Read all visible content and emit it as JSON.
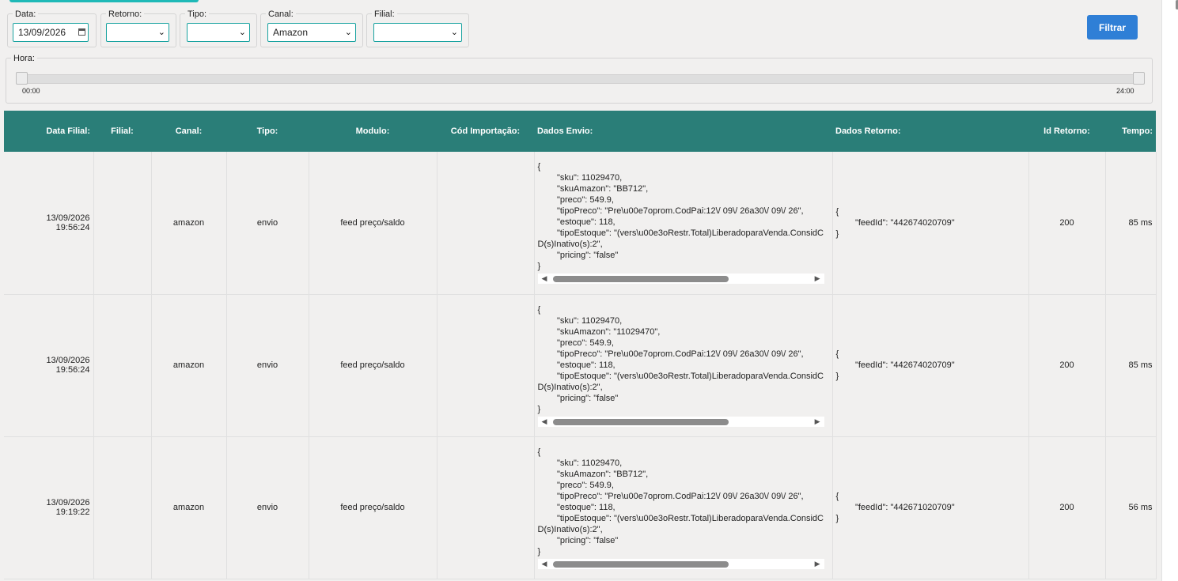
{
  "filters": {
    "data": {
      "legend": "Data:",
      "value": "13/09/2026"
    },
    "retorno": {
      "legend": "Retorno:",
      "value": ""
    },
    "tipo": {
      "legend": "Tipo:",
      "value": ""
    },
    "canal": {
      "legend": "Canal:",
      "value": "Amazon"
    },
    "filial": {
      "legend": "Filial:",
      "value": ""
    },
    "filtrar_label": "Filtrar"
  },
  "hora": {
    "legend": "Hora:",
    "min_label": "00:00",
    "max_label": "24:00",
    "range_start": 0,
    "range_end": 1
  },
  "table": {
    "headers": {
      "data_filial": "Data Filial:",
      "filial": "Filial:",
      "canal": "Canal:",
      "tipo": "Tipo:",
      "modulo": "Modulo:",
      "cod_importacao": "Cód Importação:",
      "dados_envio": "Dados Envio:",
      "dados_retorno": "Dados Retorno:",
      "id_retorno": "Id Retorno:",
      "tempo": "Tempo:"
    },
    "rows": [
      {
        "date": "13/09/2026",
        "time": "19:56:24",
        "filial": "",
        "canal": "amazon",
        "tipo": "envio",
        "modulo": "feed preço/saldo",
        "cod": "",
        "envio": "{\n        \"sku\": 11029470,\n        \"skuAmazon\": \"BB712\",\n        \"preco\": 549.9,\n        \"tipoPreco\": \"Pre\\u00e7oprom.CodPai:12\\/ 09\\/ 26a30\\/ 09\\/ 26\",\n        \"estoque\": 118,\n        \"tipoEstoque\": \"(vers\\u00e3oRestr.Total)LiberadoparaVenda.ConsidCD(s)Inativo(s):2\",\n        \"pricing\": \"false\"\n}",
        "retorno": "{\n        \"feedId\": \"442674020709\"\n}",
        "id_retorno": "200",
        "tempo": "85 ms"
      },
      {
        "date": "13/09/2026",
        "time": "19:56:24",
        "filial": "",
        "canal": "amazon",
        "tipo": "envio",
        "modulo": "feed preço/saldo",
        "cod": "",
        "envio": "{\n        \"sku\": 11029470,\n        \"skuAmazon\": \"11029470\",\n        \"preco\": 549.9,\n        \"tipoPreco\": \"Pre\\u00e7oprom.CodPai:12\\/ 09\\/ 26a30\\/ 09\\/ 26\",\n        \"estoque\": 118,\n        \"tipoEstoque\": \"(vers\\u00e3oRestr.Total)LiberadoparaVenda.ConsidCD(s)Inativo(s):2\",\n        \"pricing\": \"false\"\n}",
        "retorno": "{\n        \"feedId\": \"442674020709\"\n}",
        "id_retorno": "200",
        "tempo": "85 ms"
      },
      {
        "date": "13/09/2026",
        "time": "19:19:22",
        "filial": "",
        "canal": "amazon",
        "tipo": "envio",
        "modulo": "feed preço/saldo",
        "cod": "",
        "envio": "{\n        \"sku\": 11029470,\n        \"skuAmazon\": \"BB712\",\n        \"preco\": 549.9,\n        \"tipoPreco\": \"Pre\\u00e7oprom.CodPai:12\\/ 09\\/ 26a30\\/ 09\\/ 26\",\n        \"estoque\": 118,\n        \"tipoEstoque\": \"(vers\\u00e3oRestr.Total)LiberadoparaVenda.ConsidCD(s)Inativo(s):2\",\n        \"pricing\": \"false\"\n}",
        "retorno": "{\n        \"feedId\": \"442671020709\"\n}",
        "id_retorno": "200",
        "tempo": "56 ms"
      }
    ]
  },
  "icons": {
    "calendar": "calendar-icon",
    "dropdown": "chevron-down-icon",
    "scroll_left": "triangle-left-icon",
    "scroll_right": "triangle-right-icon"
  },
  "colors": {
    "header_bg": "#2a7e78",
    "button": "#2f7fd6",
    "accent": "#1fb9b7"
  }
}
